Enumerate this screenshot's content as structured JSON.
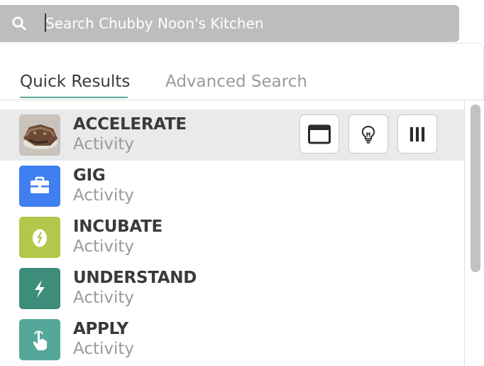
{
  "search": {
    "placeholder": "Search Chubby Noon's Kitchen",
    "icon": "search-icon"
  },
  "tabs": [
    {
      "label": "Quick Results",
      "active": true
    },
    {
      "label": "Advanced Search",
      "active": false
    }
  ],
  "results": [
    {
      "title": "ACCELERATE",
      "subtitle": "Activity",
      "icon": "food-photo-thumbnail"
    },
    {
      "title": "GIG",
      "subtitle": "Activity",
      "icon": "toolbox-icon",
      "color": "#3f7ff0"
    },
    {
      "title": "INCUBATE",
      "subtitle": "Activity",
      "icon": "egg-icon",
      "color": "#b3c84a"
    },
    {
      "title": "UNDERSTAND",
      "subtitle": "Activity",
      "icon": "lightning-icon",
      "color": "#3e8c7a"
    },
    {
      "title": "APPLY",
      "subtitle": "Activity",
      "icon": "pointer-hand-icon",
      "color": "#55a79a"
    }
  ],
  "row_actions": [
    "window-icon",
    "lightbulb-icon",
    "columns-icon"
  ],
  "colors": {
    "search_bar": "#bdbdbd",
    "tab_underline": "#5aa79a",
    "hover_row": "#e9eaeb"
  }
}
